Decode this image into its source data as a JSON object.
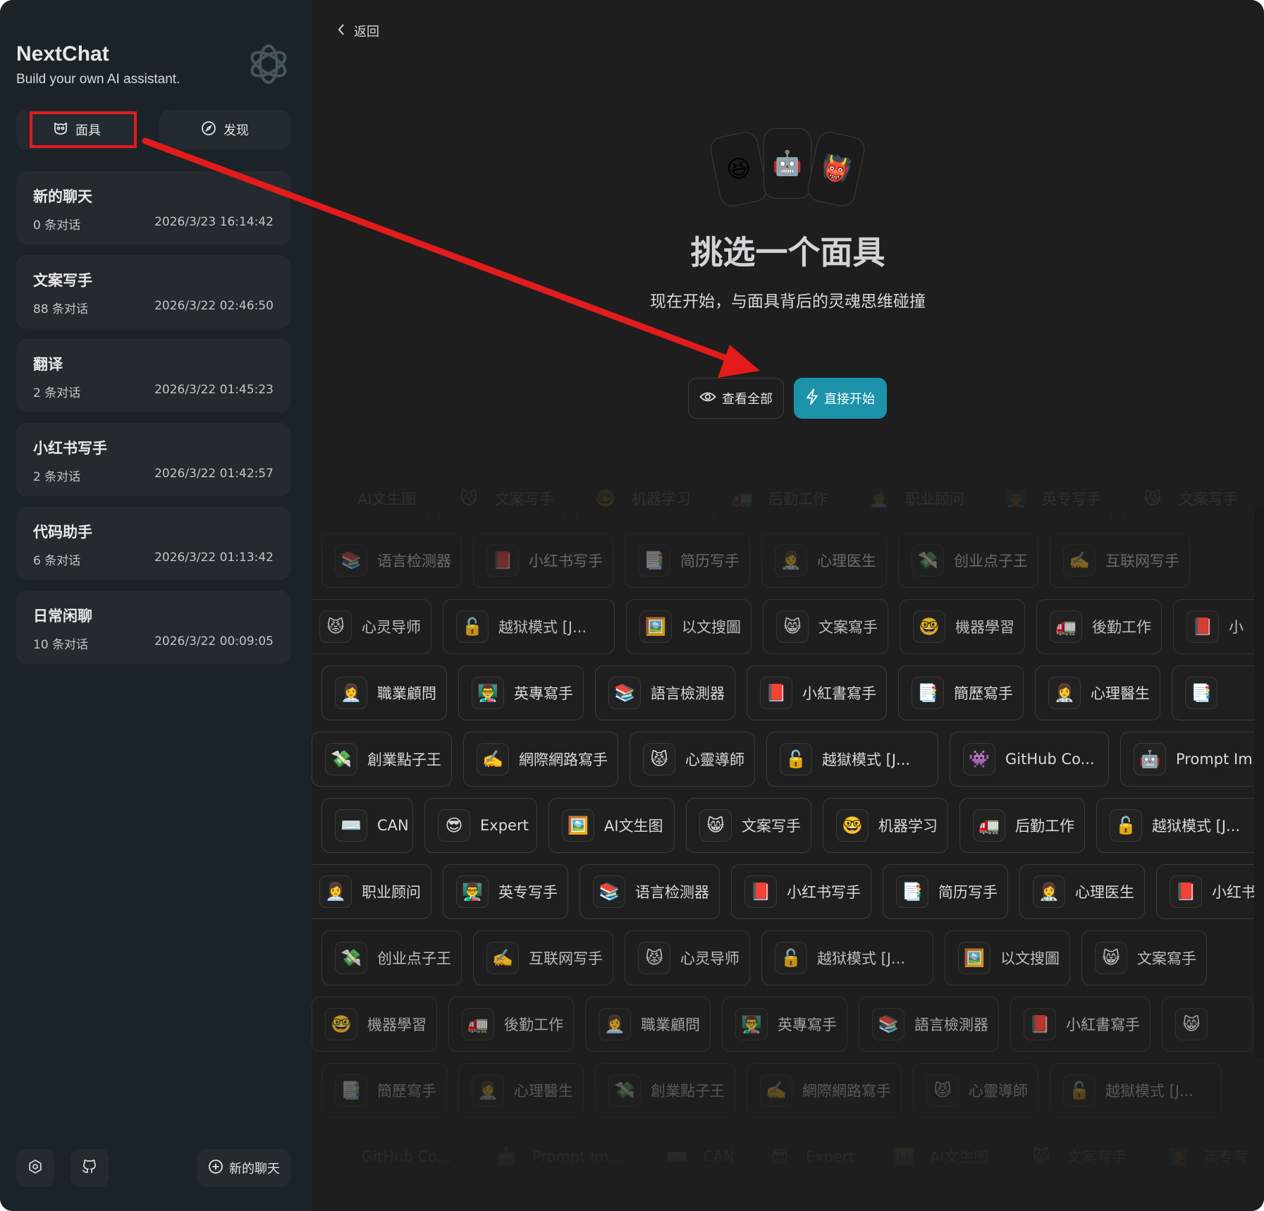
{
  "brand": {
    "title": "NextChat",
    "subtitle": "Build your own AI assistant."
  },
  "sidebar": {
    "mask_label": "面具",
    "discover_label": "发现",
    "new_chat_label": "新的聊天",
    "chats": [
      {
        "title": "新的聊天",
        "count": "0 条对话",
        "date": "2026/3/23 16:14:42"
      },
      {
        "title": "文案写手",
        "count": "88 条对话",
        "date": "2026/3/22 02:46:50"
      },
      {
        "title": "翻译",
        "count": "2 条对话",
        "date": "2026/3/22 01:45:23"
      },
      {
        "title": "小红书写手",
        "count": "2 条对话",
        "date": "2026/3/22 01:42:57"
      },
      {
        "title": "代码助手",
        "count": "6 条对话",
        "date": "2026/3/22 01:13:42"
      },
      {
        "title": "日常闲聊",
        "count": "10 条对话",
        "date": "2026/3/22 00:09:05"
      }
    ]
  },
  "main": {
    "back_label": "返回",
    "hero_emojis": [
      "😆",
      "🤖",
      "👹"
    ],
    "title": "挑选一个面具",
    "subtitle": "现在开始，与面具背后的灵魂思维碰撞",
    "view_all_label": "查看全部",
    "start_label": "直接开始"
  },
  "mask_rows": [
    [
      {
        "e": "",
        "t": "AI文生图"
      },
      {
        "e": "😼",
        "t": "文案写手"
      },
      {
        "e": "🤓",
        "t": "机器学习"
      },
      {
        "e": "🚛",
        "t": "后勤工作"
      },
      {
        "e": "👩‍💼",
        "t": "职业顾问"
      },
      {
        "e": "👨‍🏫",
        "t": "英专写手"
      },
      {
        "e": "😼",
        "t": "文案写手"
      }
    ],
    [
      {
        "e": "📚",
        "t": "语言检测器"
      },
      {
        "e": "📕",
        "t": "小红书写手"
      },
      {
        "e": "📑",
        "t": "简历写手"
      },
      {
        "e": "👩‍⚕️",
        "t": "心理医生"
      },
      {
        "e": "💸",
        "t": "创业点子王"
      },
      {
        "e": "✍️",
        "t": "互联网写手"
      }
    ],
    [
      {
        "e": "😾",
        "t": "心灵导师"
      },
      {
        "e": "🔓",
        "t": "越狱模式 [J..."
      },
      {
        "e": "🖼️",
        "t": "以文搜圖"
      },
      {
        "e": "😸",
        "t": "文案寫手"
      },
      {
        "e": "🤓",
        "t": "機器學習"
      },
      {
        "e": "🚛",
        "t": "後勤工作"
      },
      {
        "e": "📕",
        "t": "小"
      }
    ],
    [
      {
        "e": "👩‍💼",
        "t": "職業顧問"
      },
      {
        "e": "👨‍🏫",
        "t": "英專寫手"
      },
      {
        "e": "📚",
        "t": "語言檢測器"
      },
      {
        "e": "📕",
        "t": "小紅書寫手"
      },
      {
        "e": "📑",
        "t": "簡歷寫手"
      },
      {
        "e": "👩‍⚕️",
        "t": "心理醫生"
      },
      {
        "e": "📑",
        "t": ""
      }
    ],
    [
      {
        "e": "💸",
        "t": "創業點子王"
      },
      {
        "e": "✍️",
        "t": "網際網路寫手"
      },
      {
        "e": "😾",
        "t": "心靈導師"
      },
      {
        "e": "🔓",
        "t": "越獄模式 [J..."
      },
      {
        "e": "👾",
        "t": "GitHub Co..."
      },
      {
        "e": "🤖",
        "t": "Prompt Im..."
      }
    ],
    [
      {
        "e": "⌨️",
        "t": "CAN"
      },
      {
        "e": "😎",
        "t": "Expert"
      },
      {
        "e": "🖼️",
        "t": "AI文生图"
      },
      {
        "e": "😸",
        "t": "文案写手"
      },
      {
        "e": "🤓",
        "t": "机器学习"
      },
      {
        "e": "🚛",
        "t": "后勤工作"
      },
      {
        "e": "🔓",
        "t": "越狱模式 [J..."
      }
    ],
    [
      {
        "e": "👩‍💼",
        "t": "职业顾问"
      },
      {
        "e": "👨‍🏫",
        "t": "英专写手"
      },
      {
        "e": "📚",
        "t": "语言检测器"
      },
      {
        "e": "📕",
        "t": "小红书写手"
      },
      {
        "e": "📑",
        "t": "简历写手"
      },
      {
        "e": "👩‍⚕️",
        "t": "心理医生"
      },
      {
        "e": "📕",
        "t": "小红书写手"
      }
    ],
    [
      {
        "e": "💸",
        "t": "创业点子王"
      },
      {
        "e": "✍️",
        "t": "互联网写手"
      },
      {
        "e": "😾",
        "t": "心灵导师"
      },
      {
        "e": "🔓",
        "t": "越狱模式 [J..."
      },
      {
        "e": "🖼️",
        "t": "以文搜圖"
      },
      {
        "e": "😸",
        "t": "文案寫手"
      }
    ],
    [
      {
        "e": "🤓",
        "t": "機器學習"
      },
      {
        "e": "🚛",
        "t": "後勤工作"
      },
      {
        "e": "👩‍💼",
        "t": "職業顧問"
      },
      {
        "e": "👨‍🏫",
        "t": "英專寫手"
      },
      {
        "e": "📚",
        "t": "語言檢測器"
      },
      {
        "e": "📕",
        "t": "小紅書寫手"
      },
      {
        "e": "😸",
        "t": ""
      }
    ],
    [
      {
        "e": "📑",
        "t": "簡歷寫手"
      },
      {
        "e": "👩‍⚕️",
        "t": "心理醫生"
      },
      {
        "e": "💸",
        "t": "創業點子王"
      },
      {
        "e": "✍️",
        "t": "網際網路寫手"
      },
      {
        "e": "😾",
        "t": "心靈導師"
      },
      {
        "e": "🔓",
        "t": "越獄模式 [J..."
      }
    ],
    [
      {
        "e": "",
        "t": "GitHub Co..."
      },
      {
        "e": "🤖",
        "t": "Prompt Im..."
      },
      {
        "e": "⌨️",
        "t": "CAN"
      },
      {
        "e": "😎",
        "t": "Expert"
      },
      {
        "e": "🖼️",
        "t": "AI文生图"
      },
      {
        "e": "😸",
        "t": "文案写手"
      },
      {
        "e": "👨‍🏫",
        "t": "英专写"
      }
    ]
  ],
  "icons": {
    "brand_logo": "openai-logo-icon",
    "mask": "mask-icon",
    "discover": "compass-icon",
    "settings": "settings-icon",
    "github": "github-icon",
    "new_chat": "plus-circle-icon",
    "back": "chevron-left-icon",
    "view_all": "eye-icon",
    "start": "lightning-icon"
  },
  "colors": {
    "accent": "#1d93ab",
    "annotation": "#e21b1b",
    "sidebar_bg": "#1c2328",
    "main_bg": "#1e1e1e"
  }
}
